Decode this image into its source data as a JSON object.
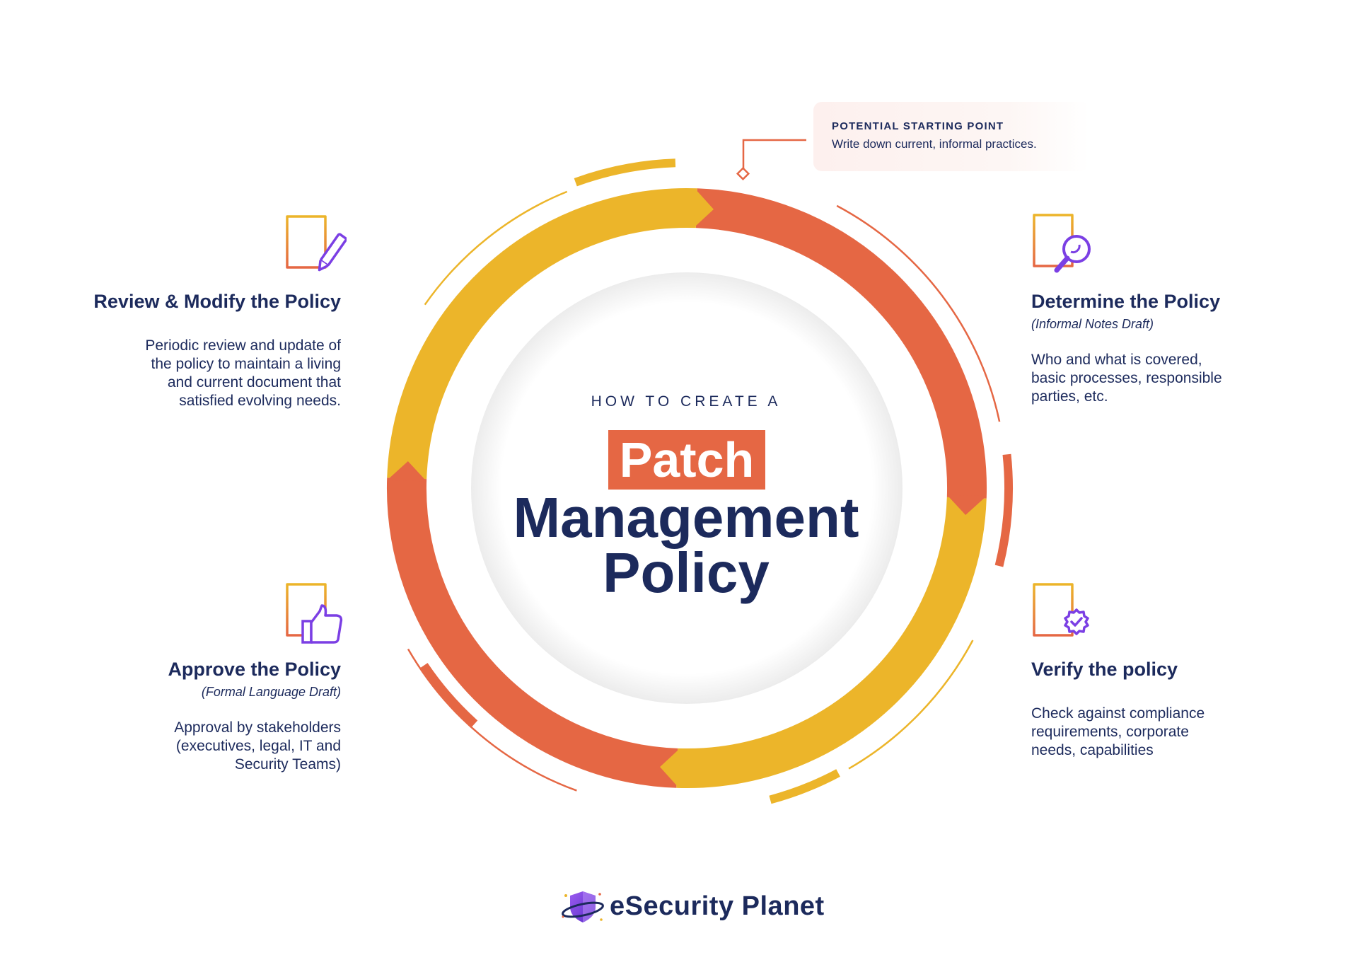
{
  "colors": {
    "navy": "#1c2a5c",
    "orange": "#e56744",
    "yellow": "#ecb52a",
    "purple": "#7b3fe4",
    "callout_bg": "#fdf0ee"
  },
  "callout": {
    "title": "POTENTIAL STARTING POINT",
    "text": "Write down current, informal practices."
  },
  "center": {
    "kicker": "HOW TO CREATE A",
    "highlight": "Patch",
    "line2": "Management",
    "line3": "Policy"
  },
  "steps": {
    "determine": {
      "title": "Determine the Policy",
      "subtitle": "(Informal Notes Draft)",
      "body": "Who and what is covered,\nbasic processes, responsible\nparties, etc.",
      "icon": "document-magnifier-icon"
    },
    "verify": {
      "title": "Verify the policy",
      "body": "Check against compliance\nrequirements, corporate\nneeds, capabilities",
      "icon": "document-verified-badge-icon"
    },
    "approve": {
      "title": "Approve the Policy",
      "subtitle": "(Formal Language Draft)",
      "body": "Approval by stakeholders\n(executives, legal, IT and\nSecurity Teams)",
      "icon": "document-thumbs-up-icon"
    },
    "review": {
      "title": "Review & Modify the Policy",
      "body": "Periodic review and update of\nthe policy to maintain a living\nand current document that\nsatisfied evolving needs.",
      "icon": "document-pencil-icon"
    }
  },
  "brand": {
    "name": "eSecurity Planet",
    "logo_icon": "shield-planet-logo-icon"
  }
}
